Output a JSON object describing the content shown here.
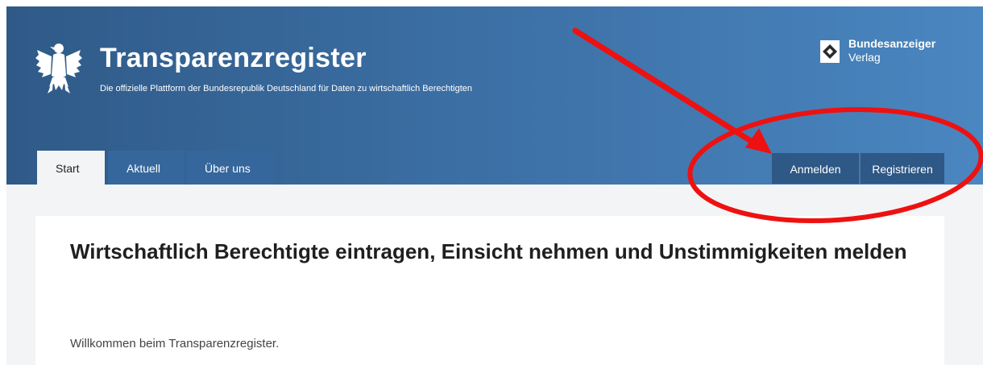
{
  "header": {
    "title": "Transparenzregister",
    "subtitle": "Die offizielle Plattform der Bundesrepublik Deutschland für Daten zu wirtschaftlich Berechtigten",
    "publisher": {
      "name": "Bundesanzeiger",
      "sub": "Verlag"
    }
  },
  "nav": {
    "tabs": [
      {
        "label": "Start",
        "active": true
      },
      {
        "label": "Aktuell",
        "active": false
      },
      {
        "label": "Über uns",
        "active": false
      }
    ]
  },
  "auth": {
    "login_label": "Anmelden",
    "register_label": "Registrieren"
  },
  "main": {
    "heading": "Wirtschaftlich Berechtigte eintragen, Einsicht nehmen und Unstimmigkeiten melden",
    "welcome": "Willkommen beim Transparenzregister."
  },
  "icons": {
    "emblem": "federal-eagle-icon",
    "publisher_mark": "bundesanzeiger-logo-icon",
    "annotation_arrow": "arrow-icon",
    "annotation_circle": "ellipse-highlight"
  },
  "colors": {
    "header_start": "#2f5a88",
    "header_end": "#4a86c0",
    "button": "#2e5886",
    "annotation": "#ee1111"
  }
}
